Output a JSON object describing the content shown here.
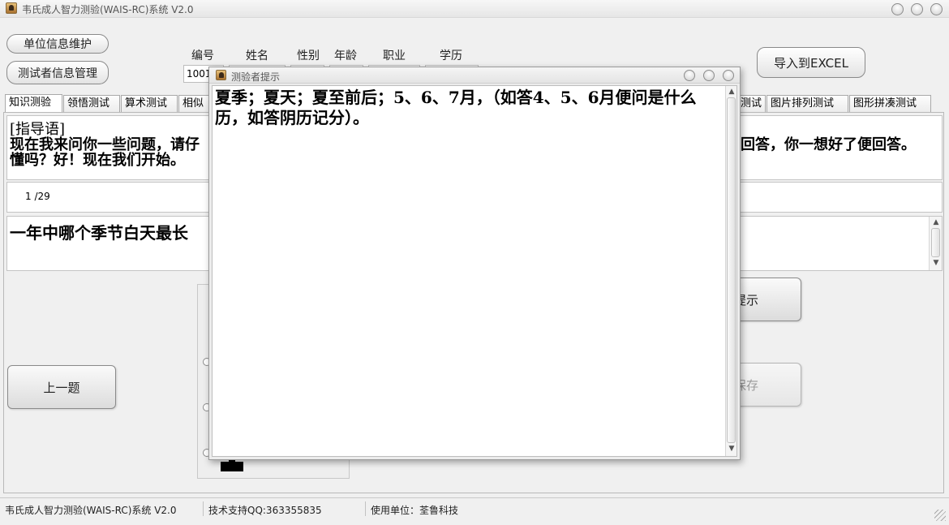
{
  "window": {
    "title": "韦氏成人智力测验(WAIS-RC)系统 V2.0"
  },
  "top_buttons": {
    "unit_info": "单位信息维护",
    "tester_info": "测试者信息管理",
    "export_excel": "导入到EXCEL"
  },
  "header_fields": {
    "labels": [
      "编号",
      "姓名",
      "性别",
      "年龄",
      "职业",
      "学历"
    ],
    "id_value": "1001"
  },
  "tabs": [
    "知识测验",
    "领悟测试",
    "算术测试",
    "相似",
    "测试",
    "图片排列测试",
    "图形拼凑测试"
  ],
  "instruction": {
    "title": "[指导语]",
    "line1_left": "现在我来问你一些问题，请仔",
    "line1_right": "回答，你一想好了便回答。",
    "line2": "懂吗？好！现在我们开始。"
  },
  "progress": "1 /29",
  "question": "一年中哪个季节白天最长",
  "buttons": {
    "prev": "上一题",
    "hint_partial": "提示",
    "save_partial": "保存"
  },
  "dialog": {
    "title": "测验者提示",
    "text": "夏季；夏天；夏至前后；5、6、7月，（如答4、5、6月便问是什么历，如答阴历记分）。"
  },
  "statusbar": {
    "app": "韦氏成人智力测验(WAIS-RC)系统 V2.0",
    "support": "技术支持QQ:363355835",
    "unit": "使用单位：荃鲁科技"
  },
  "colors": {
    "window_bg": "#f0f0f0",
    "panel_bg": "#ffffff",
    "border": "#c4c4c4"
  }
}
